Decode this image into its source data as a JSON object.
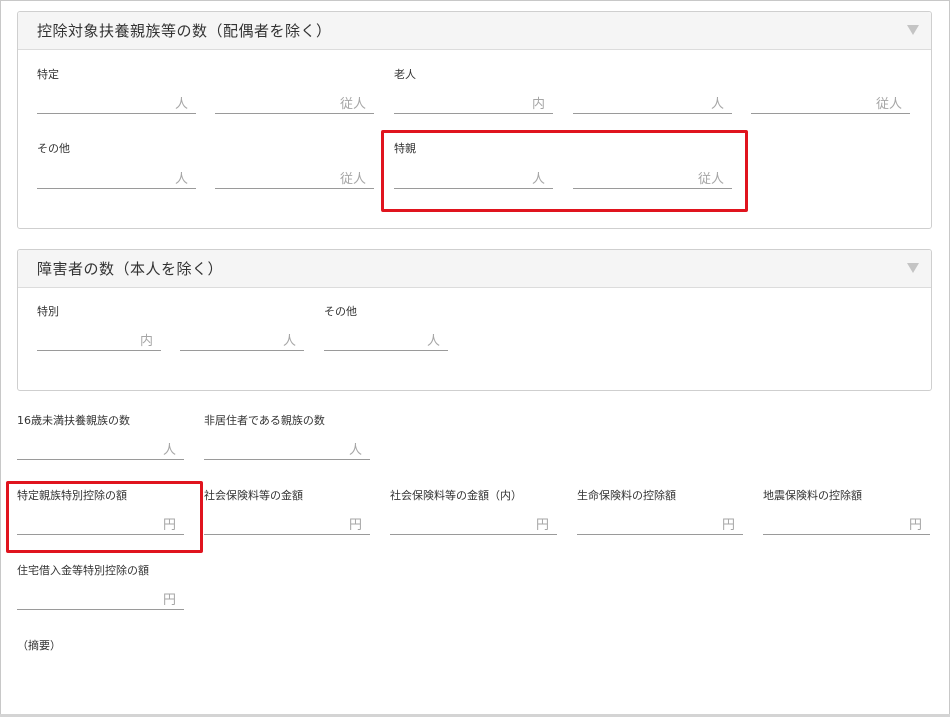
{
  "dependents_panel": {
    "title": "控除対象扶養親族等の数（配偶者を除く）",
    "tokutei_label": "特定",
    "tokutei_fields": [
      {
        "unit": "人"
      },
      {
        "unit": "従人"
      }
    ],
    "rojin_label": "老人",
    "rojin_fields": [
      {
        "unit": "内"
      },
      {
        "unit": "人"
      },
      {
        "unit": "従人"
      }
    ],
    "sonota_label": "その他",
    "sonota_fields": [
      {
        "unit": "人"
      },
      {
        "unit": "従人"
      }
    ],
    "tokushin_label": "特親",
    "tokushin_fields": [
      {
        "unit": "人"
      },
      {
        "unit": "従人"
      }
    ]
  },
  "disabled_panel": {
    "title": "障害者の数（本人を除く）",
    "tokubetsu_label": "特別",
    "tokubetsu_fields": [
      {
        "unit": "内"
      },
      {
        "unit": "人"
      }
    ],
    "sonota_label": "その他",
    "sonota_fields": [
      {
        "unit": "人"
      }
    ]
  },
  "misc": {
    "under16_label": "16歳未満扶養親族の数",
    "under16_unit": "人",
    "nonresident_label": "非居住者である親族の数",
    "nonresident_unit": "人",
    "special_spouse_label": "特定親族特別控除の額",
    "special_spouse_unit": "円",
    "social_insurance_label": "社会保険料等の金額",
    "social_insurance_unit": "円",
    "social_insurance_inner_label": "社会保険料等の金額（内）",
    "social_insurance_inner_unit": "円",
    "life_insurance_label": "生命保険料の控除額",
    "life_insurance_unit": "円",
    "earthquake_label": "地震保険料の控除額",
    "earthquake_unit": "円",
    "housing_loan_label": "住宅借入金等特別控除の額",
    "housing_loan_unit": "円",
    "summary_label": "（摘要）"
  },
  "colors": {
    "highlight": "#e0141e",
    "unit_text": "#a6a6a6",
    "header_bg": "#f5f5f5"
  }
}
